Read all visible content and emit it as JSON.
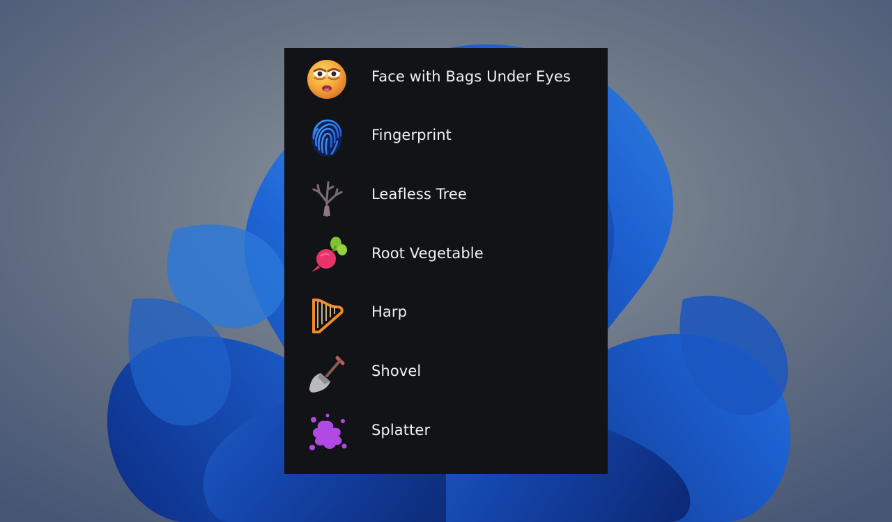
{
  "menu": {
    "items": [
      {
        "label": "Face with Bags Under Eyes",
        "icon": "face-with-bags-under-eyes-icon"
      },
      {
        "label": "Fingerprint",
        "icon": "fingerprint-icon"
      },
      {
        "label": "Leafless Tree",
        "icon": "leafless-tree-icon"
      },
      {
        "label": "Root Vegetable",
        "icon": "root-vegetable-icon"
      },
      {
        "label": "Harp",
        "icon": "harp-icon"
      },
      {
        "label": "Shovel",
        "icon": "shovel-icon"
      },
      {
        "label": "Splatter",
        "icon": "splatter-icon"
      }
    ]
  },
  "colors": {
    "panel_background": "#121316",
    "text": "#f2f2f2",
    "wallpaper_background": "#59677f",
    "wallpaper_bloom": "#1f58c7"
  }
}
